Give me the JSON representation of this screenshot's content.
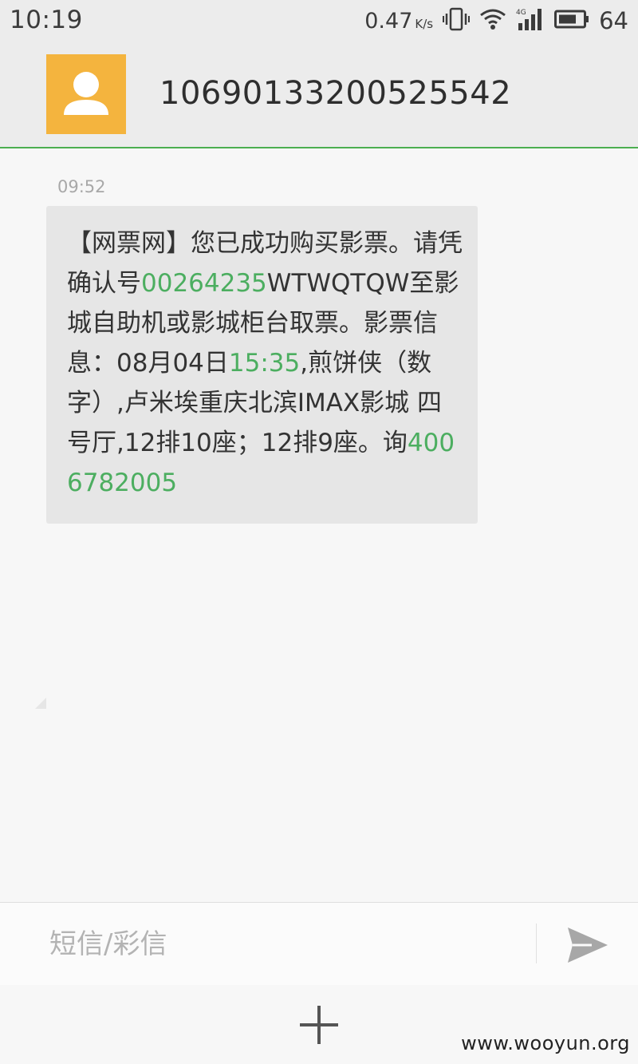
{
  "status_bar": {
    "time": "10:19",
    "net_speed": "0.47",
    "net_speed_unit": "K/s",
    "network_type": "4G",
    "battery": "64",
    "icons": [
      "vibrate-icon",
      "wifi-icon",
      "signal-4g-icon",
      "battery-icon"
    ]
  },
  "header": {
    "contact_number": "10690133200525542",
    "avatar_icon": "person-icon",
    "avatar_color": "#f4b43e",
    "accent_color": "#4caf50"
  },
  "thread": {
    "messages": [
      {
        "time": "09:52",
        "parts": [
          {
            "text": "【网票网】您已成功购买影票。请凭确认号",
            "highlight": false
          },
          {
            "text": "00264235",
            "highlight": true
          },
          {
            "text": "WTWQTQW至影城自助机或影城柜台取票。影票信息：08月04日",
            "highlight": false
          },
          {
            "text": "15:35",
            "highlight": true
          },
          {
            "text": ",煎饼侠（数字）,卢米埃重庆北滨IMAX影城 四号厅,12排10座；12排9座。询",
            "highlight": false
          },
          {
            "text": "4006782005",
            "highlight": true
          }
        ]
      }
    ],
    "highlight_color": "#4cae60"
  },
  "composer": {
    "placeholder": "短信/彩信",
    "value": "",
    "send_icon": "send-icon"
  },
  "bottom_bar": {
    "add_icon": "plus-icon",
    "watermark": "www.wooyun.org"
  }
}
